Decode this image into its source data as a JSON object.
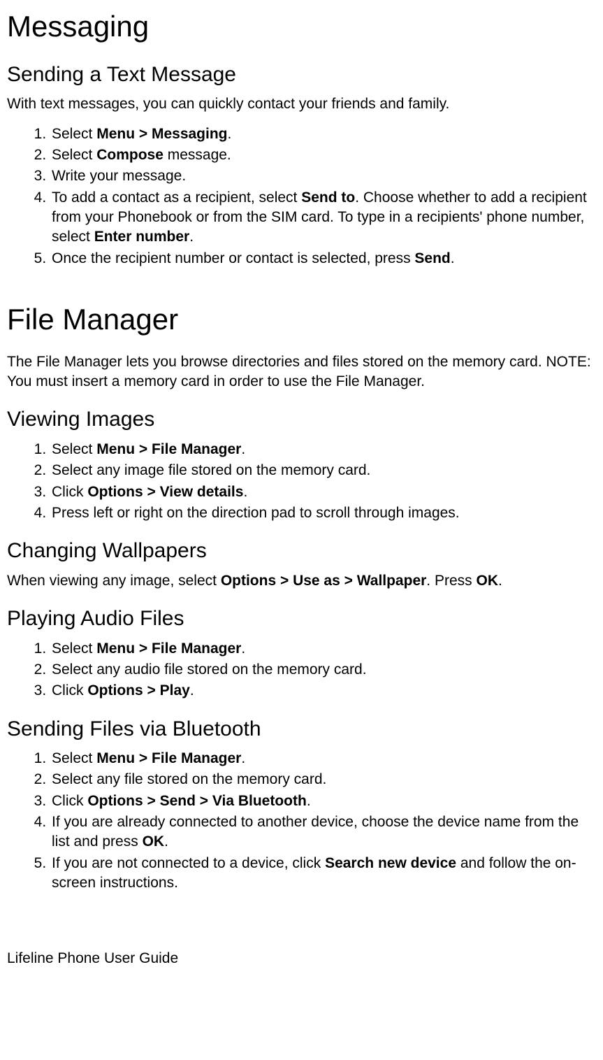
{
  "messaging": {
    "title": "Messaging",
    "sending": {
      "heading": "Sending a Text Message",
      "intro": "With text messages, you can quickly contact your friends and family.",
      "steps": {
        "s1_a": "Select ",
        "s1_b": "Menu > Messaging",
        "s1_c": ".",
        "s2_a": "Select ",
        "s2_b": "Compose",
        "s2_c": " message.",
        "s3": "Write your message.",
        "s4_a": "To add a contact as a recipient, select ",
        "s4_b": "Send to",
        "s4_c": ". Choose whether to add a recipient from your Phonebook or from the SIM card. To type in a recipients' phone number, select ",
        "s4_d": "Enter number",
        "s4_e": ".",
        "s5_a": "Once the recipient number or contact is selected, press ",
        "s5_b": "Send",
        "s5_c": "."
      }
    }
  },
  "filemanager": {
    "title": "File Manager",
    "intro": "The File Manager lets you browse directories and files stored on the memory card. NOTE: You must insert a memory card in order to use the File Manager.",
    "viewing": {
      "heading": "Viewing Images",
      "s1_a": "Select ",
      "s1_b": "Menu > File Manager",
      "s1_c": ".",
      "s2": "Select any image file stored on the memory card.",
      "s3_a": "Click ",
      "s3_b": "Options > View details",
      "s3_c": ".",
      "s4": "Press left or right on the direction pad to scroll through images."
    },
    "wallpapers": {
      "heading": "Changing Wallpapers",
      "p_a": "When viewing any image, select ",
      "p_b": "Options > Use as > Wallpaper",
      "p_c": ". Press ",
      "p_d": "OK",
      "p_e": "."
    },
    "audio": {
      "heading": "Playing Audio Files",
      "s1_a": "Select ",
      "s1_b": "Menu > File Manager",
      "s1_c": ".",
      "s2": "Select any audio file stored on the memory card.",
      "s3_a": "Click ",
      "s3_b": "Options > Play",
      "s3_c": "."
    },
    "bluetooth": {
      "heading": "Sending Files via Bluetooth",
      "s1_a": "Select ",
      "s1_b": "Menu > File Manager",
      "s1_c": ".",
      "s2": "Select any file stored on the memory card.",
      "s3_a": "Click ",
      "s3_b": "Options > Send > Via Bluetooth",
      "s3_c": ".",
      "s4_a": "If you are already connected to another device, choose the device name from the list and press ",
      "s4_b": "OK",
      "s4_c": ".",
      "s5_a": "If you are not connected to a device, click ",
      "s5_b": "Search new device",
      "s5_c": " and follow the on-screen instructions."
    }
  },
  "footer": "Lifeline Phone User Guide"
}
